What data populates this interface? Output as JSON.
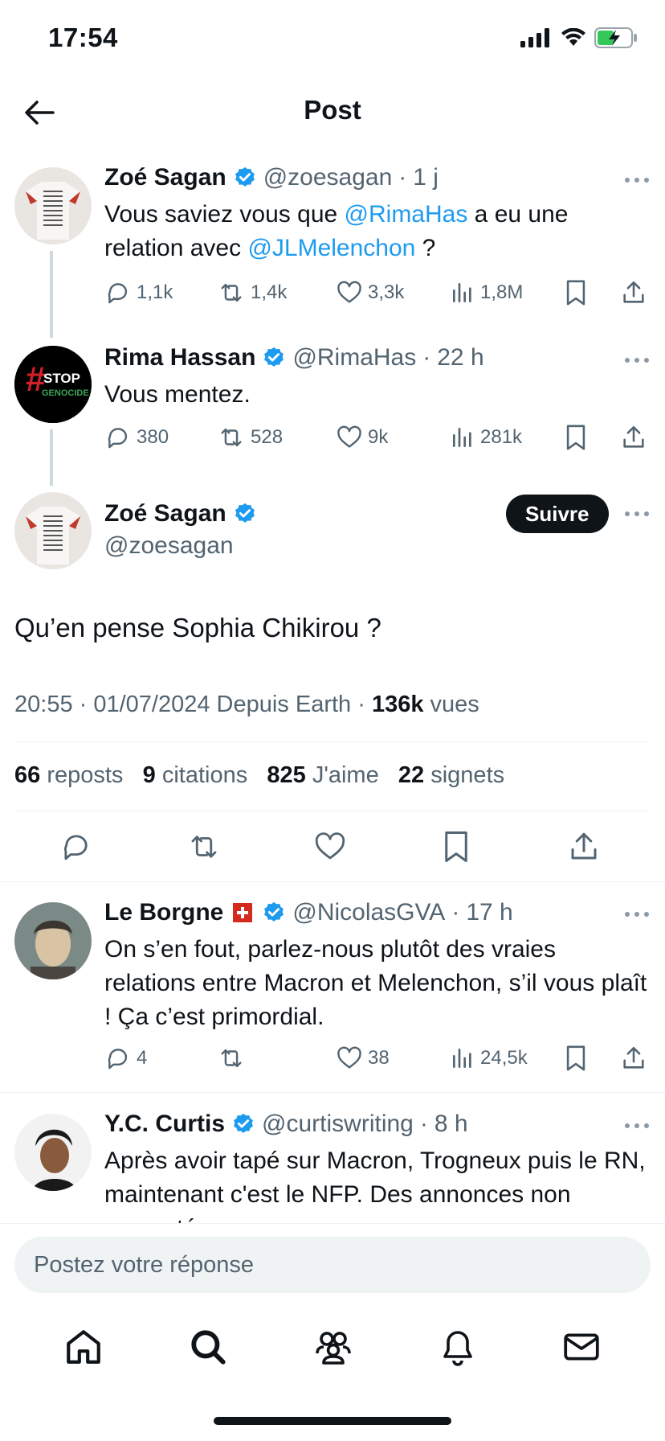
{
  "status": {
    "time": "17:54"
  },
  "header": {
    "title": "Post"
  },
  "thread": [
    {
      "name": "Zoé Sagan",
      "handle": "@zoesagan",
      "time": "1 j",
      "text_parts": [
        "Vous saviez vous que ",
        "@RimaHas",
        " a eu une relation avec ",
        "@JLMelenchon",
        " ?"
      ],
      "replies": "1,1k",
      "reposts": "1,4k",
      "likes": "3,3k",
      "views": "1,8M"
    },
    {
      "name": "Rima Hassan",
      "handle": "@RimaHas",
      "time": "22 h",
      "text": "Vous mentez.",
      "avatar_text": [
        "STOP",
        "GENOCIDE"
      ],
      "replies": "380",
      "reposts": "528",
      "likes": "9k",
      "views": "281k"
    }
  ],
  "main_post": {
    "name": "Zoé Sagan",
    "handle": "@zoesagan",
    "follow_label": "Suivre",
    "text": "Qu’en pense Sophia Chikirou ?",
    "meta_prefix": "20:55 · 01/07/2024 Depuis Earth · ",
    "views_count": "136k",
    "views_label": " vues",
    "stats": [
      {
        "count": "66",
        "label": "reposts"
      },
      {
        "count": "9",
        "label": "citations"
      },
      {
        "count": "825",
        "label": "J'aime"
      },
      {
        "count": "22",
        "label": "signets"
      }
    ]
  },
  "replies": [
    {
      "name": "Le Borgne",
      "flag": "🇨🇭",
      "handle": "@NicolasGVA",
      "time": "17 h",
      "text": "On s’en fout, parlez-nous plutôt des vraies relations entre Macron et Melenchon, s’il vous plaît ! Ça c’est primordial.",
      "replies": "4",
      "reposts": "",
      "likes": "38",
      "views": "24,5k"
    },
    {
      "name": "Y.C. Curtis",
      "handle": "@curtiswriting",
      "time": "8 h",
      "text": "Après avoir tapé sur Macron, Trogneux puis le RN, maintenant c'est le NFP. Des annonces non respectées"
    }
  ],
  "reply_box": {
    "placeholder": "Postez votre réponse"
  },
  "colors": {
    "accent": "#1d9bf0",
    "verified": "#1d9bf0",
    "text": "#0f1419",
    "muted": "#536471"
  }
}
